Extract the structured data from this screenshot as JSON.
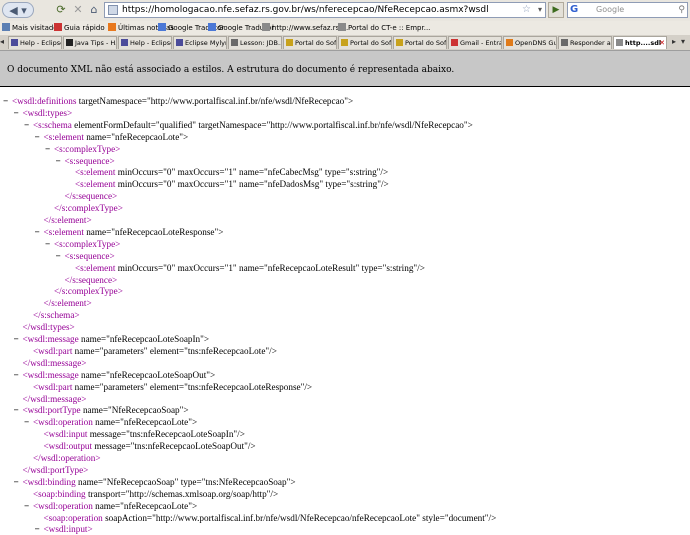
{
  "browser": {
    "url": "https://homologacao.nfe.sefaz.rs.gov.br/ws/nferecepcao/NfeRecepcao.asmx?wsdl",
    "search_placeholder": "Google",
    "search_logo": "G"
  },
  "bookmarks": [
    {
      "label": "Mais visitados",
      "icon": "page-icon",
      "color": "#5b7fb3"
    },
    {
      "label": "Guia rápido",
      "icon": "red-page-icon",
      "color": "#c33"
    },
    {
      "label": "Últimas notícias",
      "icon": "rss-icon",
      "color": "#e8791e"
    },
    {
      "label": "Google Tradutor",
      "icon": "google-icon",
      "color": "#4b78d6"
    },
    {
      "label": "Google Tradutor",
      "icon": "google-icon",
      "color": "#4b78d6"
    },
    {
      "label": "http://www.sefaz.rs....",
      "icon": "page-icon",
      "color": "#8a8a8a"
    },
    {
      "label": "Portal do CT-e :: Empr...",
      "icon": "page-icon",
      "color": "#8a8a8a"
    }
  ],
  "tabs": [
    {
      "label": "Help - Eclipse...",
      "icon_color": "#4c4c9a"
    },
    {
      "label": "Java Tips - H...",
      "icon_color": "#222"
    },
    {
      "label": "Help - Eclipse...",
      "icon_color": "#4c4c9a"
    },
    {
      "label": "Eclipse Mylyn...",
      "icon_color": "#4c4c9a"
    },
    {
      "label": "Lesson: JDB...",
      "icon_color": "#6a6a6a"
    },
    {
      "label": "Portal do Sof...",
      "icon_color": "#c8a21c"
    },
    {
      "label": "Portal do Sof...",
      "icon_color": "#c8a21c"
    },
    {
      "label": "Portal do Sof...",
      "icon_color": "#c8a21c"
    },
    {
      "label": "Gmail - Entra...",
      "icon_color": "#c33"
    },
    {
      "label": "OpenDNS Gu...",
      "icon_color": "#e07b1a"
    },
    {
      "label": "Responder a ...",
      "icon_color": "#6a6a6a"
    },
    {
      "label": "http....sdl",
      "icon_color": "#8a8a8a"
    }
  ],
  "banner": {
    "text": "O documento XML não está associado a estilos. A estrutura do documento é representada abaixo."
  },
  "xml_lines": [
    {
      "indent": 0,
      "marker": "−",
      "tag": "<wsdl:definitions",
      "attrs": " targetNamespace=\"http://www.portalfiscal.inf.br/nfe/wsdl/NfeRecepcao\">"
    },
    {
      "indent": 1,
      "marker": "−",
      "tag": "<wsdl:types>",
      "attrs": ""
    },
    {
      "indent": 2,
      "marker": "−",
      "tag": "<s:schema",
      "attrs": " elementFormDefault=\"qualified\" targetNamespace=\"http://www.portalfiscal.inf.br/nfe/wsdl/NfeRecepcao\">"
    },
    {
      "indent": 3,
      "marker": "−",
      "tag": "<s:element",
      "attrs": " name=\"nfeRecepcaoLote\">"
    },
    {
      "indent": 4,
      "marker": "−",
      "tag": "<s:complexType>",
      "attrs": ""
    },
    {
      "indent": 5,
      "marker": "−",
      "tag": "<s:sequence>",
      "attrs": ""
    },
    {
      "indent": 6,
      "marker": "",
      "tag": "<s:element",
      "attrs": " minOccurs=\"0\" maxOccurs=\"1\" name=\"nfeCabecMsg\" type=\"s:string\"/>"
    },
    {
      "indent": 6,
      "marker": "",
      "tag": "<s:element",
      "attrs": " minOccurs=\"0\" maxOccurs=\"1\" name=\"nfeDadosMsg\" type=\"s:string\"/>"
    },
    {
      "indent": 5,
      "marker": "",
      "tag": "</s:sequence>",
      "attrs": ""
    },
    {
      "indent": 4,
      "marker": "",
      "tag": "</s:complexType>",
      "attrs": ""
    },
    {
      "indent": 3,
      "marker": "",
      "tag": "</s:element>",
      "attrs": ""
    },
    {
      "indent": 3,
      "marker": "−",
      "tag": "<s:element",
      "attrs": " name=\"nfeRecepcaoLoteResponse\">"
    },
    {
      "indent": 4,
      "marker": "−",
      "tag": "<s:complexType>",
      "attrs": ""
    },
    {
      "indent": 5,
      "marker": "−",
      "tag": "<s:sequence>",
      "attrs": ""
    },
    {
      "indent": 6,
      "marker": "",
      "tag": "<s:element",
      "attrs": " minOccurs=\"0\" maxOccurs=\"1\" name=\"nfeRecepcaoLoteResult\" type=\"s:string\"/>"
    },
    {
      "indent": 5,
      "marker": "",
      "tag": "</s:sequence>",
      "attrs": ""
    },
    {
      "indent": 4,
      "marker": "",
      "tag": "</s:complexType>",
      "attrs": ""
    },
    {
      "indent": 3,
      "marker": "",
      "tag": "</s:element>",
      "attrs": ""
    },
    {
      "indent": 2,
      "marker": "",
      "tag": "</s:schema>",
      "attrs": ""
    },
    {
      "indent": 1,
      "marker": "",
      "tag": "</wsdl:types>",
      "attrs": ""
    },
    {
      "indent": 1,
      "marker": "−",
      "tag": "<wsdl:message",
      "attrs": " name=\"nfeRecepcaoLoteSoapIn\">"
    },
    {
      "indent": 2,
      "marker": "",
      "tag": "<wsdl:part",
      "attrs": " name=\"parameters\" element=\"tns:nfeRecepcaoLote\"/>"
    },
    {
      "indent": 1,
      "marker": "",
      "tag": "</wsdl:message>",
      "attrs": ""
    },
    {
      "indent": 1,
      "marker": "−",
      "tag": "<wsdl:message",
      "attrs": " name=\"nfeRecepcaoLoteSoapOut\">"
    },
    {
      "indent": 2,
      "marker": "",
      "tag": "<wsdl:part",
      "attrs": " name=\"parameters\" element=\"tns:nfeRecepcaoLoteResponse\"/>"
    },
    {
      "indent": 1,
      "marker": "",
      "tag": "</wsdl:message>",
      "attrs": ""
    },
    {
      "indent": 1,
      "marker": "−",
      "tag": "<wsdl:portType",
      "attrs": " name=\"NfeRecepcaoSoap\">"
    },
    {
      "indent": 2,
      "marker": "−",
      "tag": "<wsdl:operation",
      "attrs": " name=\"nfeRecepcaoLote\">"
    },
    {
      "indent": 3,
      "marker": "",
      "tag": "<wsdl:input",
      "attrs": " message=\"tns:nfeRecepcaoLoteSoapIn\"/>"
    },
    {
      "indent": 3,
      "marker": "",
      "tag": "<wsdl:output",
      "attrs": " message=\"tns:nfeRecepcaoLoteSoapOut\"/>"
    },
    {
      "indent": 2,
      "marker": "",
      "tag": "</wsdl:operation>",
      "attrs": ""
    },
    {
      "indent": 1,
      "marker": "",
      "tag": "</wsdl:portType>",
      "attrs": ""
    },
    {
      "indent": 1,
      "marker": "−",
      "tag": "<wsdl:binding",
      "attrs": " name=\"NfeRecepcaoSoap\" type=\"tns:NfeRecepcaoSoap\">"
    },
    {
      "indent": 2,
      "marker": "",
      "tag": "<soap:binding",
      "attrs": " transport=\"http://schemas.xmlsoap.org/soap/http\"/>"
    },
    {
      "indent": 2,
      "marker": "−",
      "tag": "<wsdl:operation",
      "attrs": " name=\"nfeRecepcaoLote\">"
    },
    {
      "indent": 3,
      "marker": "",
      "tag": "<soap:operation",
      "attrs": " soapAction=\"http://www.portalfiscal.inf.br/nfe/wsdl/NfeRecepcao/nfeRecepcaoLote\" style=\"document\"/>"
    },
    {
      "indent": 3,
      "marker": "−",
      "tag": "<wsdl:input>",
      "attrs": ""
    }
  ]
}
